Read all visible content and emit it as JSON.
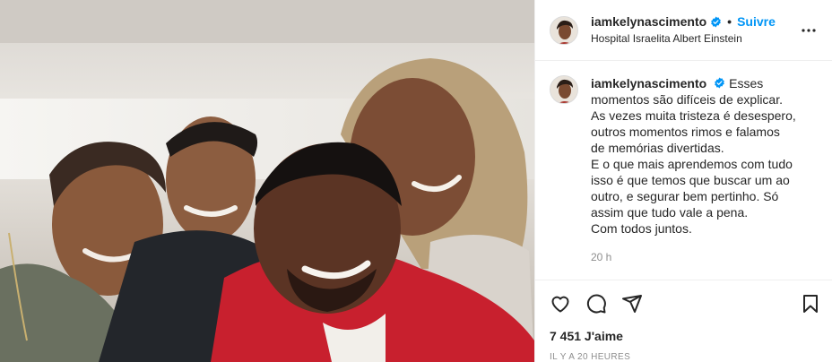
{
  "post": {
    "username": "iamkelynascimento",
    "follow_label": "Suivre",
    "separator": "•",
    "location": "Hospital Israelita Albert Einstein",
    "caption_lines": [
      "Esses",
      "momentos são difíceis de explicar.",
      "As vezes muita tristeza é desespero,",
      "outros momentos rimos e falamos",
      "de memórias divertidas.",
      "E o que mais aprendemos com tudo",
      "isso é que temos que buscar um ao",
      "outro, e segurar bem pertinho. Só",
      "assim que tudo vale a pena.",
      "Com todos juntos."
    ],
    "caption_time": "20 h",
    "likes": "7 451 J'aime",
    "posted_ago": "IL Y A 20 HEURES"
  },
  "icons": {
    "verified": "verified-badge-icon",
    "more": "more-options-icon",
    "like": "heart-icon",
    "comment": "comment-icon",
    "share": "share-icon",
    "save": "bookmark-icon"
  },
  "colors": {
    "accent": "#0095f6",
    "text": "#262626",
    "secondary": "#8e8e8e",
    "border": "#efefef"
  }
}
